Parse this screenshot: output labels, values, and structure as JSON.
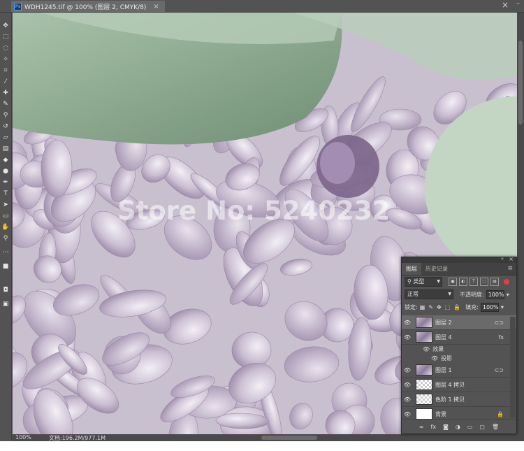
{
  "title_bar": {
    "ps_badge": "Ps",
    "tab_title": "WDH1245.tif @ 100% (图层 2, CMYK/8)",
    "tab_close": "×",
    "close": "×",
    "minimize": "–"
  },
  "toolbar": {
    "tools": [
      {
        "name": "move-tool-icon",
        "glyph": "✥"
      },
      {
        "name": "marquee-tool-icon",
        "glyph": "⬚"
      },
      {
        "name": "lasso-tool-icon",
        "glyph": "◌"
      },
      {
        "name": "magic-wand-icon",
        "glyph": "✧"
      },
      {
        "name": "crop-tool-icon",
        "glyph": "⌗"
      },
      {
        "name": "eyedropper-icon",
        "glyph": "⁄"
      },
      {
        "name": "healing-brush-icon",
        "glyph": "✚"
      },
      {
        "name": "brush-tool-icon",
        "glyph": "✎"
      },
      {
        "name": "stamp-tool-icon",
        "glyph": "⚲"
      },
      {
        "name": "history-brush-icon",
        "glyph": "↺"
      },
      {
        "name": "eraser-icon",
        "glyph": "▱"
      },
      {
        "name": "gradient-tool-icon",
        "glyph": "▤"
      },
      {
        "name": "blur-tool-icon",
        "glyph": "◆"
      },
      {
        "name": "dodge-tool-icon",
        "glyph": "●"
      },
      {
        "name": "pen-tool-icon",
        "glyph": "✒"
      },
      {
        "name": "type-tool-icon",
        "glyph": "T"
      },
      {
        "name": "path-select-icon",
        "glyph": "➤"
      },
      {
        "name": "rectangle-tool-icon",
        "glyph": "▭"
      },
      {
        "name": "hand-tool-icon",
        "glyph": "✋"
      },
      {
        "name": "zoom-tool-icon",
        "glyph": "⚲"
      },
      {
        "name": "more-tools-icon",
        "glyph": "⋯"
      },
      {
        "name": "color-swatch-icon",
        "glyph": "■"
      },
      {
        "name": "quick-mask-icon",
        "glyph": "◘"
      },
      {
        "name": "screen-mode-icon",
        "glyph": "▣"
      }
    ]
  },
  "canvas": {
    "watermark": "Store No: 5240232"
  },
  "status": {
    "zoom": "100%",
    "doc_info": "文档:196.2M/977.1M",
    "arrow": "›"
  },
  "panel": {
    "collapse": "«",
    "close": "×",
    "tabs": [
      "图层",
      "历史记录"
    ],
    "menu": "≡",
    "filter": {
      "label": "类型",
      "icon": "⚲"
    },
    "filter_buttons": [
      "▣",
      "◐",
      "T",
      "⬚",
      "▤"
    ],
    "blend_mode": "正常",
    "opacity_label": "不透明度:",
    "opacity_value": "100%",
    "lock_label": "锁定:",
    "lock_icons": [
      "▦",
      "✎",
      "✥",
      "⬚",
      "🔒"
    ],
    "fill_label": "填充:",
    "fill_value": "100%",
    "layers": [
      {
        "name": "图层 2",
        "thumb": "flower",
        "selected": true,
        "right": "⊂⊃"
      },
      {
        "name": "图层 4",
        "thumb": "flower",
        "selected": false,
        "right": "fx"
      },
      {
        "name": "图层 1",
        "thumb": "flower",
        "selected": false,
        "right": "⊂⊃"
      },
      {
        "name": "图层 4 拷贝",
        "thumb": "check",
        "selected": false,
        "right": ""
      },
      {
        "name": "色阶 1 拷贝",
        "thumb": "check",
        "selected": false,
        "right": ""
      },
      {
        "name": "背景",
        "thumb": "white",
        "selected": false,
        "right": "🔒"
      }
    ],
    "effects_label": "效果",
    "effect_item": "投影",
    "eye": "👁",
    "footer_icons": [
      "∞",
      "fx",
      "◙",
      "◑",
      "▭",
      "▢",
      "🗑"
    ]
  }
}
